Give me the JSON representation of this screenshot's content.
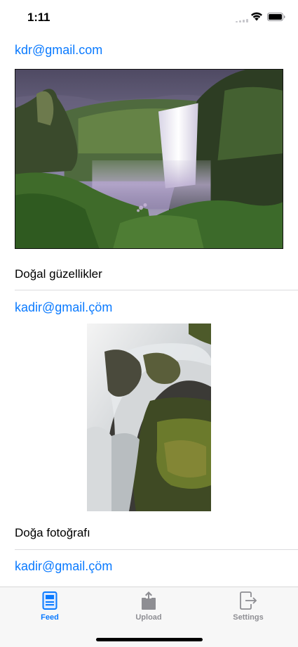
{
  "status_bar": {
    "time": "1:11"
  },
  "feed": {
    "posts": [
      {
        "email": "kdr@gmail.com",
        "caption": "Doğal güzellikler"
      },
      {
        "email": "kadir@gmail.çöm",
        "caption": "Doğa fotoğrafı"
      },
      {
        "email": "kadir@gmail.çöm",
        "caption": ""
      }
    ]
  },
  "tab_bar": {
    "tabs": [
      {
        "label": "Feed",
        "icon": "document-icon",
        "selected": true
      },
      {
        "label": "Upload",
        "icon": "share-upload-icon",
        "selected": false
      },
      {
        "label": "Settings",
        "icon": "exit-icon",
        "selected": false
      }
    ],
    "active_color": "#0a7aff",
    "inactive_color": "#8e8e93"
  },
  "colors": {
    "link": "#0a7aff",
    "tab_bar_background": "#f7f7f7"
  }
}
